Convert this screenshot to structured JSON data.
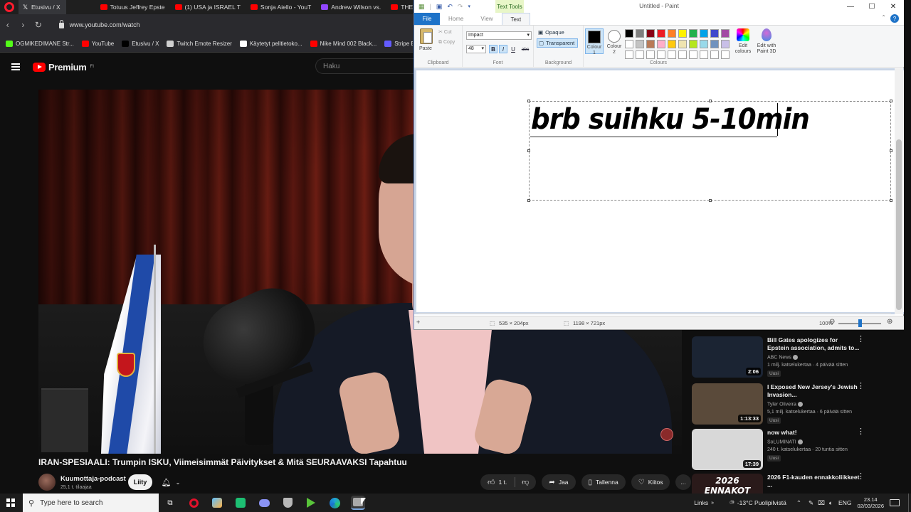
{
  "browser": {
    "tabs": [
      {
        "label": "Etusivu / X",
        "icon": "x-icon",
        "active": true
      },
      {
        "label": "Totuus Jeffrey Epste",
        "icon": "youtube-icon"
      },
      {
        "label": "(1) USA ja ISRAEL T",
        "icon": "youtube-icon"
      },
      {
        "label": "Sonja Aiello - YouT",
        "icon": "youtube-icon"
      },
      {
        "label": "Andrew Wilson vs.",
        "icon": "twitch-icon"
      },
      {
        "label": "THE FASTEST ANIM",
        "icon": "youtube-icon"
      }
    ],
    "url": "www.youtube.com/watch",
    "bookmarks": [
      {
        "label": "OGMIKEDIMANE Str...",
        "color": "#53fc18"
      },
      {
        "label": "YouTube",
        "color": "#ff0000"
      },
      {
        "label": "Etusivu / X",
        "color": "#000000"
      },
      {
        "label": "Twitch Emote Resizer",
        "color": "#cfcfcf"
      },
      {
        "label": "Käytetyt pelitietoko...",
        "color": "#ffffff"
      },
      {
        "label": "Nike Mind 002 Black...",
        "color": "#ff0000"
      },
      {
        "label": "Stripe Express",
        "color": "#635bff"
      }
    ]
  },
  "youtube": {
    "logo_text": "Premium",
    "logo_region": "FI",
    "search_placeholder": "Haku",
    "video_title": "IRAN-SPESIAALI: Trumpin ISKU, Viimeisimmät Päivitykset & Mitä SEURAAVAKSI Tapahtuu",
    "channel_name": "Kuumottaja-podcast",
    "channel_subs": "25,1 t. tilaajaa",
    "join_label": "Liity",
    "like_count": "1 t.",
    "share_label": "Jaa",
    "save_label": "Tallenna",
    "thanks_label": "Kiitos",
    "more_label": "...",
    "recommendations": [
      {
        "title": "Bill Gates apologizes for Epstein association, admits to...",
        "channel": "ABC News",
        "meta": "1 milj. katselukertaa · 4 päivää sitten",
        "badge": "Uusi",
        "duration": "2:06",
        "thumb_color": "#1b2433"
      },
      {
        "title": "I Exposed New Jersey's Jewish Invasion...",
        "channel": "Tyler Oliveira",
        "meta": "5,1 milj. katselukertaa · 6 päivää sitten",
        "badge": "Uusi",
        "duration": "1:13:33",
        "thumb_color": "#5a4a3a"
      },
      {
        "title": "now what!",
        "channel": "SoLUMINATI",
        "meta": "240 t. katselukertaa · 20 tuntia sitten",
        "badge": "Uusi",
        "duration": "17:39",
        "thumb_color": "#d8d8d8"
      },
      {
        "title": "2026 F1-kauden ennakkoliikkeet ...",
        "channel": "",
        "meta": "",
        "badge": "",
        "duration": "",
        "thumb_text": "2026 ENNAKOT",
        "thumb_color": "#2a1a1a"
      }
    ]
  },
  "paint": {
    "context_tab": "Text Tools",
    "title": "Untitled - Paint",
    "tabs": [
      "File",
      "Home",
      "View",
      "Text"
    ],
    "clipboard": {
      "paste": "Paste",
      "cut": "Cut",
      "copy": "Copy",
      "label": "Clipboard"
    },
    "font": {
      "family": "Impact",
      "size": "48",
      "label": "Font",
      "bold": "B",
      "italic": "I",
      "underline": "U",
      "strike": "abc"
    },
    "background": {
      "opaque": "Opaque",
      "transparent": "Transparent",
      "label": "Background"
    },
    "colours": {
      "colour1": "Colour 1",
      "colour2": "Colour 2",
      "label": "Colours",
      "edit": "Edit colours",
      "paint3d": "Edit with Paint 3D"
    },
    "palette": [
      "#000000",
      "#7f7f7f",
      "#880015",
      "#ed1c24",
      "#ff7f27",
      "#fff200",
      "#22b14c",
      "#00a2e8",
      "#3f48cc",
      "#a349a4",
      "#ffffff",
      "#c3c3c3",
      "#b97a57",
      "#ffaec9",
      "#ffc90e",
      "#efe4b0",
      "#b5e61d",
      "#99d9ea",
      "#7092be",
      "#c8bfe7",
      "#ffffff",
      "#ffffff",
      "#ffffff",
      "#ffffff",
      "#ffffff",
      "#ffffff",
      "#ffffff",
      "#ffffff",
      "#ffffff",
      "#ffffff"
    ],
    "canvas_text": "brb suihku 5-10min",
    "status_selection": "535 × 204px",
    "status_size": "1198 × 721px",
    "zoom": "100%"
  },
  "taskbar": {
    "search_placeholder": "Type here to search",
    "links": "Links",
    "weather": "-13°C Puolipilvistä",
    "lang": "ENG",
    "time": "23.14",
    "date": "02/03/2026"
  }
}
